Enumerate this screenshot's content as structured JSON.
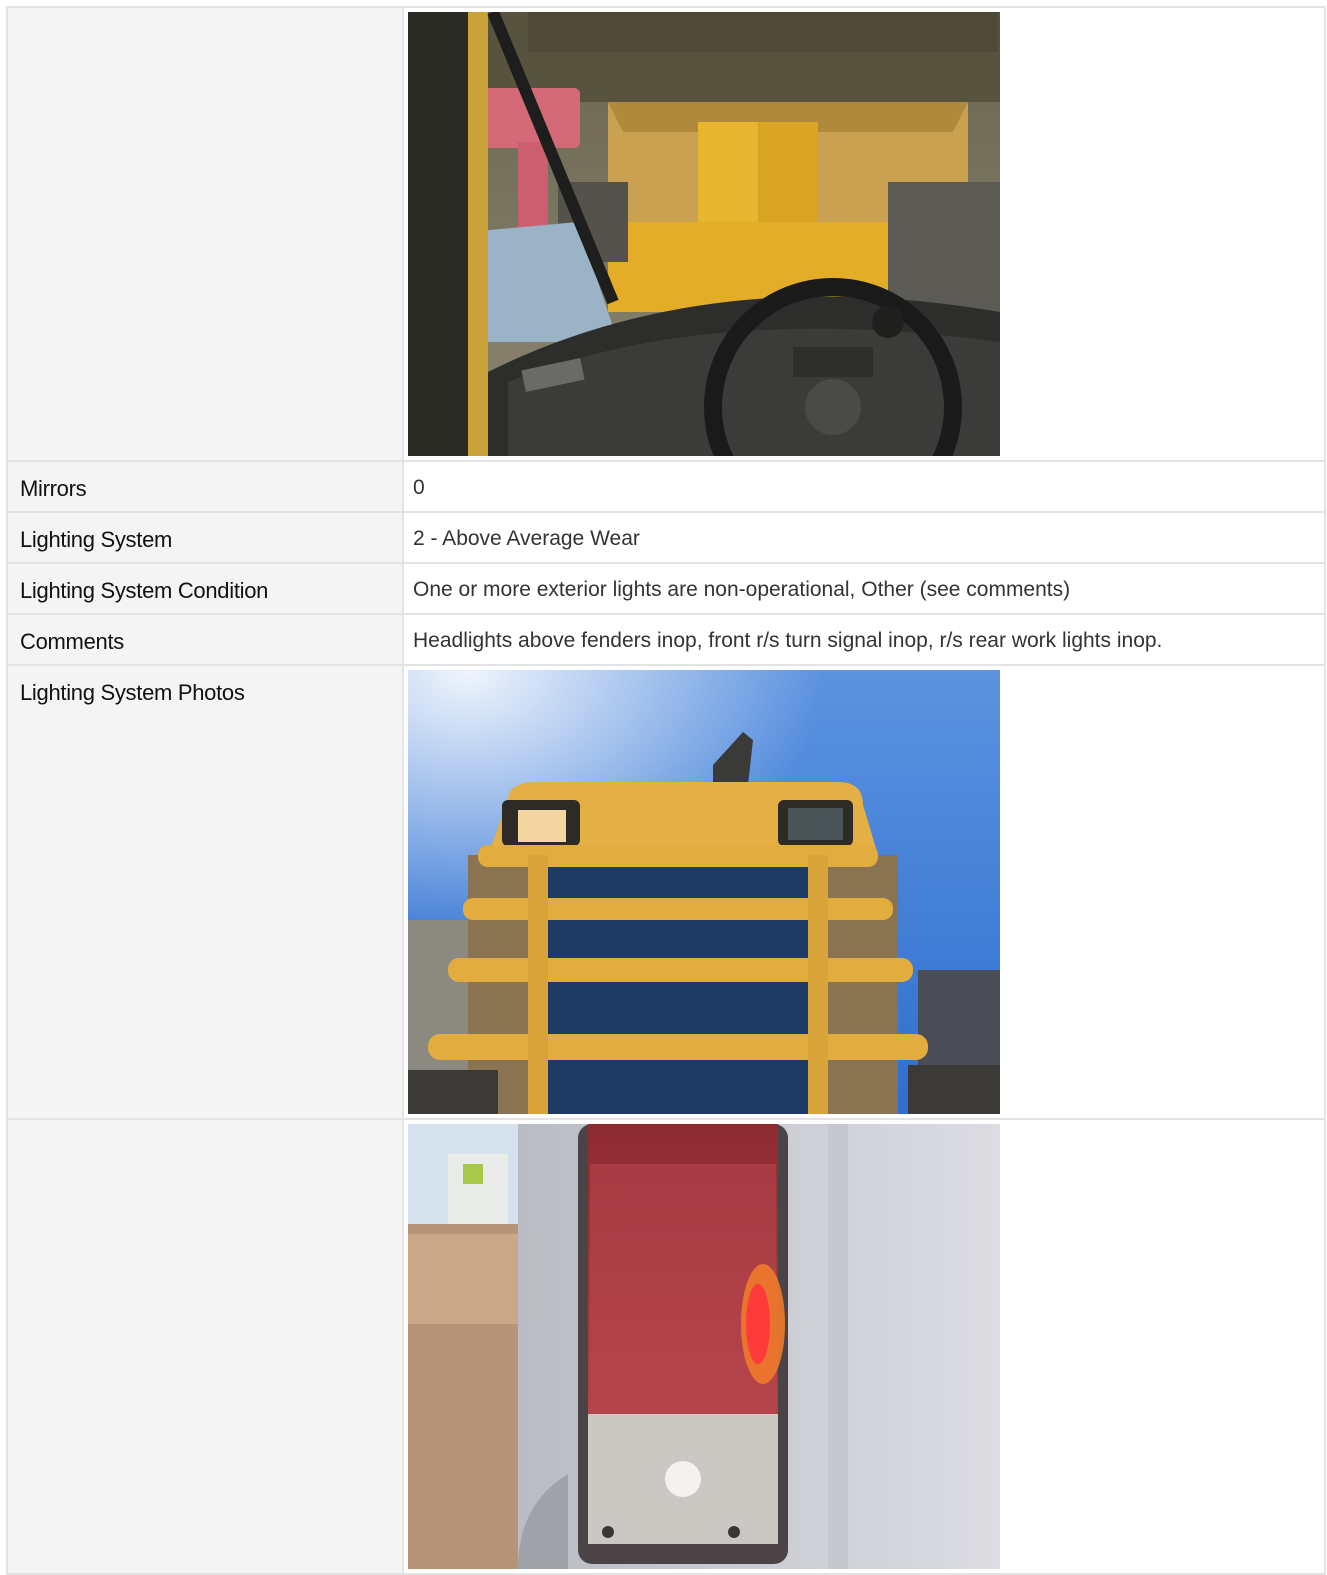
{
  "rows": {
    "mirrors": {
      "label": "Mirrors",
      "value": "0"
    },
    "lighting_system": {
      "label": "Lighting System",
      "value": "2 - Above Average Wear"
    },
    "lighting_condition": {
      "label": "Lighting System Condition",
      "value": "One or more exterior lights are non-operational, Other (see comments)"
    },
    "comments": {
      "label": "Comments",
      "value": "Headlights above fenders inop, front r/s turn signal inop, r/s rear work lights inop."
    },
    "lighting_photos": {
      "label": "Lighting System Photos"
    }
  },
  "photos": [
    {
      "icon": "photo-cab-interior-icon"
    },
    {
      "icon": "photo-front-grille-lights-icon"
    },
    {
      "icon": "photo-rear-tail-light-icon"
    }
  ],
  "colors": {
    "label_bg": "#f4f4f4",
    "border": "#e3e3e3",
    "machine_yellow": "#e5b33a",
    "sky_blue": "#3f7fd6",
    "tail_red": "#c0303a"
  }
}
